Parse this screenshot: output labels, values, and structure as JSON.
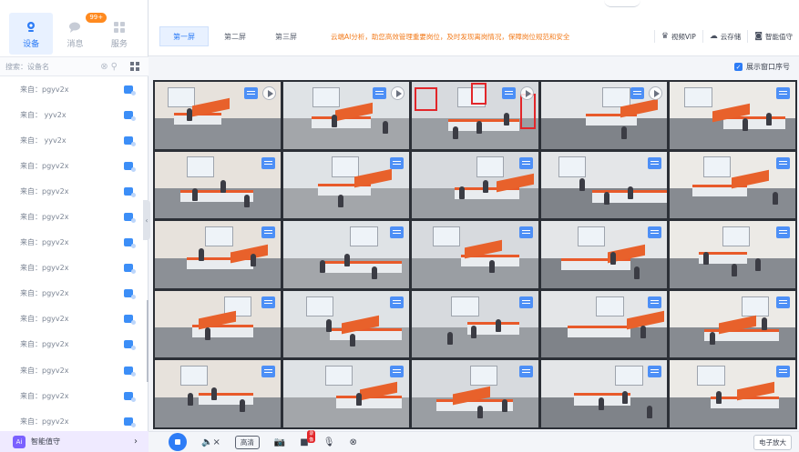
{
  "sidebar": {
    "tabs": [
      {
        "label": "设备",
        "icon": "device-icon",
        "active": true
      },
      {
        "label": "消息",
        "icon": "message-icon",
        "badge": "99+"
      },
      {
        "label": "服务",
        "icon": "service-icon"
      }
    ],
    "search_placeholder": "搜索：设备名",
    "devices": [
      "来自：pgyv2x",
      "来自：    yyv2x",
      "来自：    yyv2x",
      "来自：pgyv2x",
      "来自：pgyv2x",
      "来自：pgyv2x",
      "来自：pgyv2x",
      "来自：pgyv2x",
      "来自：pgyv2x",
      "来自：pgyv2x",
      "来自：pgyv2x",
      "来自：pgyv2x",
      "来自：pgyv2x",
      "来自：pgyv2x"
    ],
    "agent_label": "智能值守",
    "agent_logo": "Ai"
  },
  "toolbar": {
    "screens": [
      "第一屏",
      "第二屏",
      "第三屏"
    ],
    "ai_banner": "云端AI分析，助您高效管理重要岗位，及时发现离岗情况，保障岗位规范和安全",
    "vip_label": "视频VIP",
    "cloud_label": "云存储",
    "smart_label": "智能值守"
  },
  "options": {
    "show_index_label": "展示窗口序号",
    "show_index_checked": true
  },
  "controls": {
    "hd_label": "高清",
    "rec_badge": "录像",
    "zoom_label": "电子放大"
  },
  "colors": {
    "accent": "#2d7cf6",
    "banner": "#f27a1a",
    "alert": "#e2262a"
  }
}
